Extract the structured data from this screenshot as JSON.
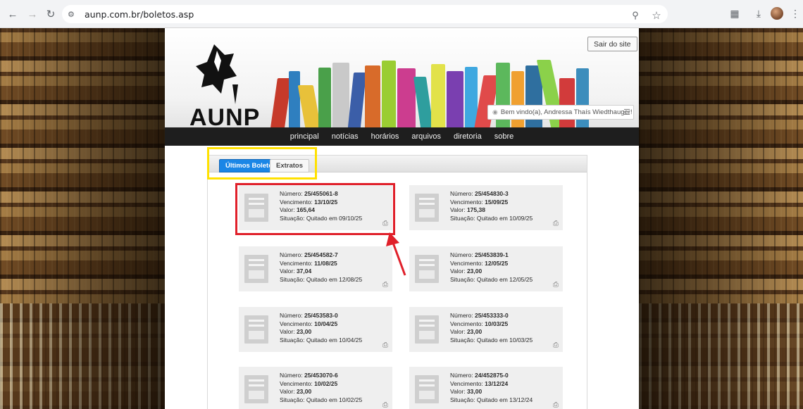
{
  "browser": {
    "url": "aunp.com.br/boletos.asp",
    "icons": [
      "back-icon",
      "forward-icon",
      "reload-icon",
      "site-settings-icon",
      "zoom-icon",
      "bookmark-star-icon",
      "extensions-icon",
      "download-icon",
      "profile-avatar",
      "more-menu-icon"
    ]
  },
  "site": {
    "logo_text": "AUNP",
    "logout_label": "Sair do site",
    "welcome_text": "Bem vindo(a), Andressa Thaís Wiedthauger!",
    "nav": [
      "principal",
      "notícias",
      "horários",
      "arquivos",
      "diretoria",
      "sobre"
    ]
  },
  "tabs": {
    "active": "Últimos Boletos",
    "inactive": "Extratos"
  },
  "labels": {
    "numero": "Número:",
    "vencimento": "Vencimento:",
    "valor": "Valor:",
    "situacao": "Situação:"
  },
  "boletos": [
    {
      "numero": "25/455061-8",
      "vencimento": "13/10/25",
      "valor": "165,64",
      "situacao": "Quitado em 09/10/25"
    },
    {
      "numero": "25/454830-3",
      "vencimento": "15/09/25",
      "valor": "175,38",
      "situacao": "Quitado em 10/09/25"
    },
    {
      "numero": "25/454582-7",
      "vencimento": "11/08/25",
      "valor": "37,04",
      "situacao": "Quitado em 12/08/25"
    },
    {
      "numero": "25/453839-1",
      "vencimento": "12/05/25",
      "valor": "23,00",
      "situacao": "Quitado em 12/05/25"
    },
    {
      "numero": "25/453583-0",
      "vencimento": "10/04/25",
      "valor": "23,00",
      "situacao": "Quitado em 10/04/25"
    },
    {
      "numero": "25/453333-0",
      "vencimento": "10/03/25",
      "valor": "23,00",
      "situacao": "Quitado em 10/03/25"
    },
    {
      "numero": "25/453070-6",
      "vencimento": "10/02/25",
      "valor": "23,00",
      "situacao": "Quitado em 10/02/25"
    },
    {
      "numero": "24/452875-0",
      "vencimento": "13/12/24",
      "valor": "33,00",
      "situacao": "Quitado em 13/12/24"
    }
  ],
  "colors": {
    "tab_active": "#1a86e6",
    "highlight_red": "#e0202a",
    "highlight_yellow": "#ffe100",
    "navbar": "#1e1e1e"
  }
}
